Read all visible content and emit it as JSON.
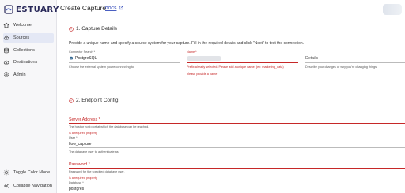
{
  "brand": {
    "name": "ESTUARY",
    "color": "#2a2a5a",
    "accent": "#4a5fc1"
  },
  "sidebar": {
    "items": [
      {
        "label": "Welcome",
        "icon": "home-icon"
      },
      {
        "label": "Sources",
        "icon": "cloud-upload-icon",
        "active": true
      },
      {
        "label": "Collections",
        "icon": "database-icon"
      },
      {
        "label": "Destinations",
        "icon": "cloud-download-icon"
      },
      {
        "label": "Admin",
        "icon": "gear-icon"
      }
    ],
    "footer": [
      {
        "label": "Toggle Color Mode",
        "icon": "sun-icon"
      },
      {
        "label": "Collapse Navigation",
        "icon": "double-chevron-left-icon"
      }
    ]
  },
  "header": {
    "title": "Create Capture",
    "docs_label": "DOCS"
  },
  "capture_details": {
    "title": "1. Capture Details",
    "description": "Provide a unique name and specify a source system for your capture. Fill in the required details and click \"Next\" to test the connection.",
    "connector": {
      "label": "Connector Search *",
      "value": "PostgreSQL",
      "helper": "Choose the external system you're connecting to."
    },
    "name": {
      "label": "Name *",
      "helper": "Prefix already selected. Please add a unique name, (ex: marketing_data)",
      "error": "please provide a name"
    },
    "details": {
      "label": "Details",
      "helper": "Describe your changes or why you're changing things."
    }
  },
  "endpoint_config": {
    "title": "2. Endpoint Config",
    "server_address": {
      "label": "Server Address *",
      "helper": "The host or host:port at which the database can be reached.",
      "error": "is a required property"
    },
    "user": {
      "label": "User *",
      "value": "flow_capture",
      "helper": "The database user to authenticate as."
    },
    "password": {
      "label": "Password *",
      "helper": "Password for the specified database user.",
      "error": "is a required property"
    },
    "database": {
      "label": "Database *",
      "value": "postgres"
    }
  },
  "colors": {
    "error": "#c62828",
    "active_bg": "#e4e8f5",
    "sidebar_bg": "#f7f7f9"
  }
}
